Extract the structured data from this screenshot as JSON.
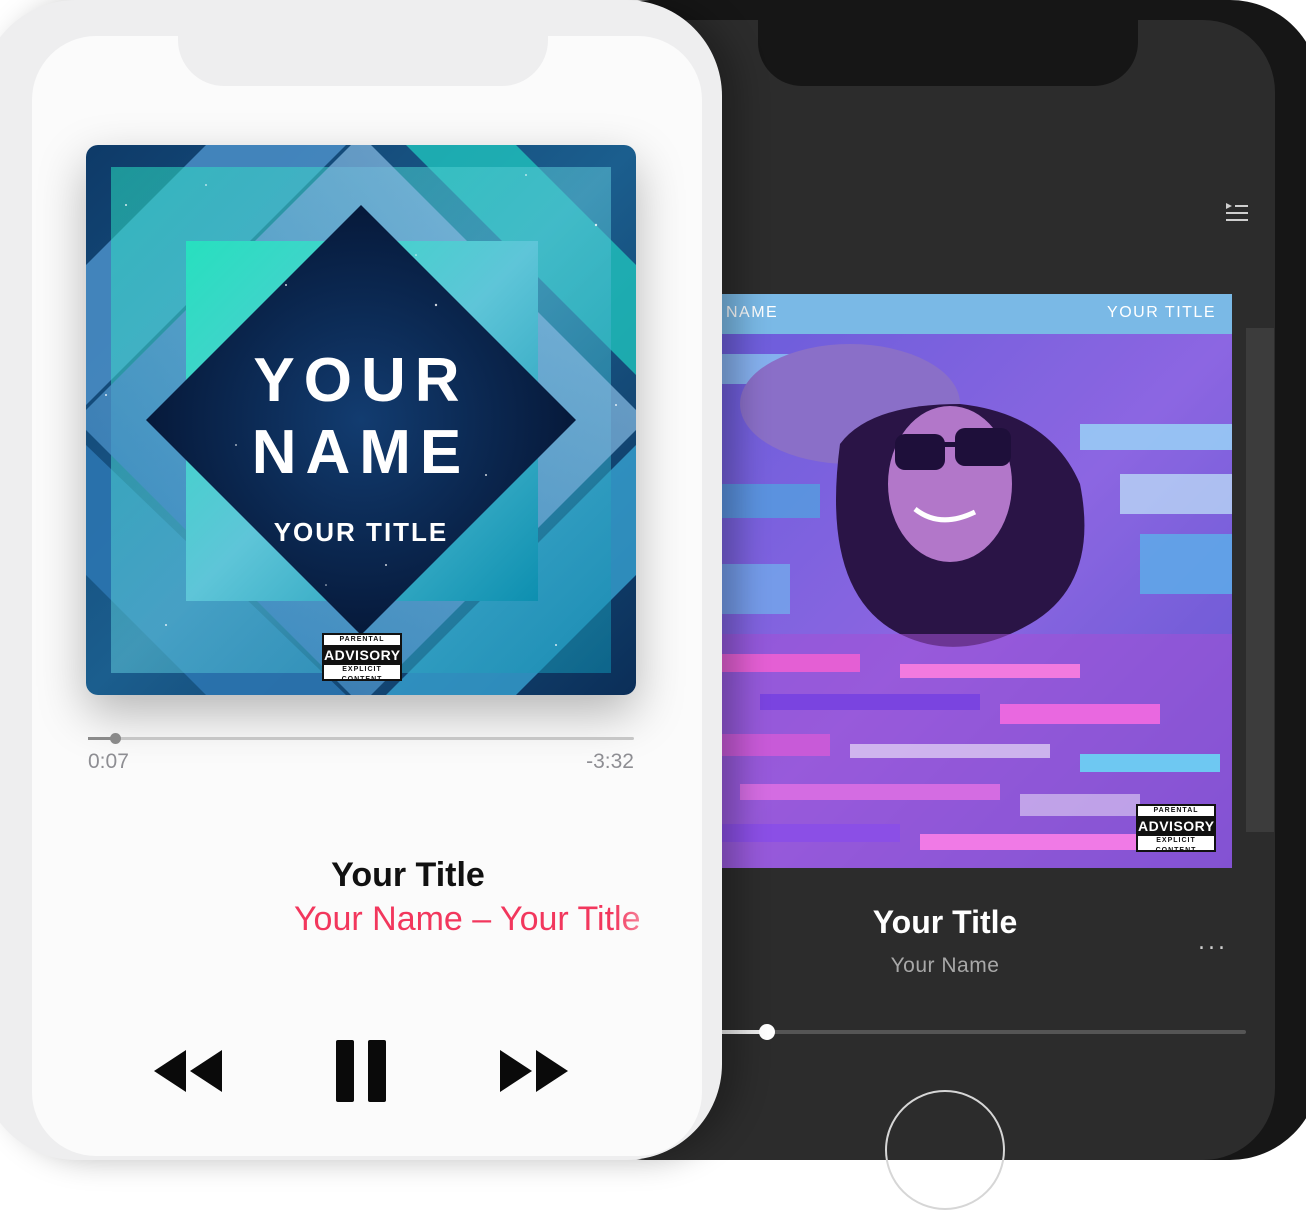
{
  "light_player": {
    "cover": {
      "name_line_1": "YOUR",
      "name_line_2": "NAME",
      "title": "YOUR TITLE",
      "advisory": {
        "top": "PARENTAL",
        "middle": "ADVISORY",
        "bottom": "EXPLICIT CONTENT"
      }
    },
    "progress": {
      "elapsed": "0:07",
      "remaining": "-3:32",
      "fraction": 0.05
    },
    "track_title": "Your Title",
    "track_subtitle": "Your Name – Your Title",
    "controls": {
      "rewind_icon": "rewind-icon",
      "pause_icon": "pause-icon",
      "forward_icon": "fast-forward-icon"
    },
    "colors": {
      "accent": "#f2375d",
      "background": "#fbfbfb"
    }
  },
  "dark_player": {
    "cover": {
      "name": "NAME",
      "title": "YOUR TITLE",
      "advisory": {
        "top": "PARENTAL",
        "middle": "ADVISORY",
        "bottom": "EXPLICIT CONTENT"
      }
    },
    "queue_icon": "queue-icon",
    "track_title": "Your Title",
    "track_artist": "Your Name",
    "more_label": "...",
    "progress": {
      "fraction": 0.09
    },
    "colors": {
      "background": "#2c2c2c",
      "text": "#ffffff",
      "muted": "#a8a8a8"
    }
  }
}
